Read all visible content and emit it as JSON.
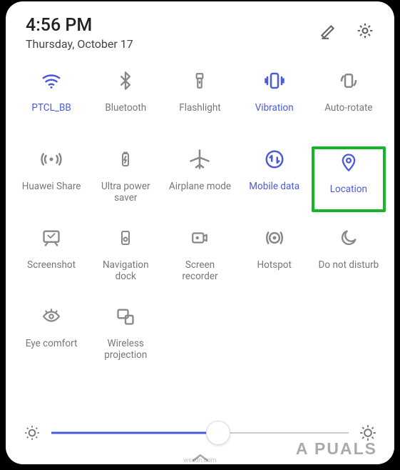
{
  "header": {
    "time": "4:56 PM",
    "date": "Thursday, October 17"
  },
  "tiles": [
    {
      "id": "wifi",
      "label": "PTCL_BB",
      "active": true,
      "icon": "wifi"
    },
    {
      "id": "bluetooth",
      "label": "Bluetooth",
      "active": false,
      "icon": "bluetooth"
    },
    {
      "id": "flashlight",
      "label": "Flashlight",
      "active": false,
      "icon": "flashlight"
    },
    {
      "id": "vibration",
      "label": "Vibration",
      "active": true,
      "icon": "vibration"
    },
    {
      "id": "autorotate",
      "label": "Auto-rotate",
      "active": false,
      "icon": "autorotate"
    },
    {
      "id": "huaweishare",
      "label": "Huawei Share",
      "active": false,
      "icon": "huaweishare"
    },
    {
      "id": "ultrapower",
      "label": "Ultra power\nsaver",
      "active": false,
      "icon": "battery"
    },
    {
      "id": "airplane",
      "label": "Airplane mode",
      "active": false,
      "icon": "airplane"
    },
    {
      "id": "mobiledata",
      "label": "Mobile data",
      "active": true,
      "icon": "mobiledata"
    },
    {
      "id": "location",
      "label": "Location",
      "active": true,
      "icon": "location",
      "highlighted": true
    },
    {
      "id": "screenshot",
      "label": "Screenshot",
      "active": false,
      "icon": "screenshot"
    },
    {
      "id": "navdock",
      "label": "Navigation\ndock",
      "active": false,
      "icon": "navdock"
    },
    {
      "id": "screenrec",
      "label": "Screen\nrecorder",
      "active": false,
      "icon": "screenrec"
    },
    {
      "id": "hotspot",
      "label": "Hotspot",
      "active": false,
      "icon": "hotspot"
    },
    {
      "id": "dnd",
      "label": "Do not disturb",
      "active": false,
      "icon": "moon"
    },
    {
      "id": "eyecomfort",
      "label": "Eye comfort",
      "active": false,
      "icon": "eye"
    },
    {
      "id": "wireless",
      "label": "Wireless\nprojection",
      "active": false,
      "icon": "projection"
    }
  ],
  "brightness": {
    "value_pct": 56
  },
  "watermark": "A  PUALS",
  "source_text": "wsxdn.com",
  "colors": {
    "accent": "#4a5bdc",
    "inactive": "#888",
    "highlight": "#14b728"
  }
}
